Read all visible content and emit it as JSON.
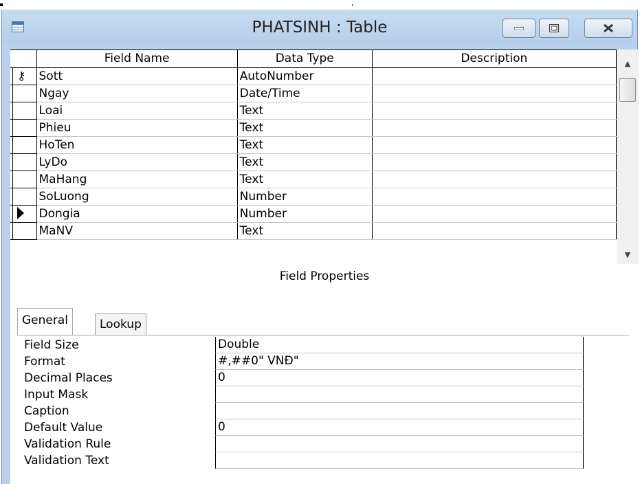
{
  "top_strip_text": ",",
  "window": {
    "title": "PHATSINH : Table",
    "controls": {
      "minimize": "minimize",
      "maximize": "maximize",
      "close": "close"
    }
  },
  "grid": {
    "headers": {
      "field_name": "Field Name",
      "data_type": "Data Type",
      "description": "Description"
    },
    "rows": [
      {
        "field": "Sott",
        "type": "AutoNumber",
        "description": "",
        "selector": "key"
      },
      {
        "field": "Ngay",
        "type": "Date/Time",
        "description": "",
        "selector": ""
      },
      {
        "field": "Loai",
        "type": "Text",
        "description": "",
        "selector": ""
      },
      {
        "field": "Phieu",
        "type": "Text",
        "description": "",
        "selector": ""
      },
      {
        "field": "HoTen",
        "type": "Text",
        "description": "",
        "selector": ""
      },
      {
        "field": "LyDo",
        "type": "Text",
        "description": "",
        "selector": ""
      },
      {
        "field": "MaHang",
        "type": "Text",
        "description": "",
        "selector": ""
      },
      {
        "field": "SoLuong",
        "type": "Number",
        "description": "",
        "selector": ""
      },
      {
        "field": "Dongia",
        "type": "Number",
        "description": "",
        "selector": "current"
      },
      {
        "field": "MaNV",
        "type": "Text",
        "description": "",
        "selector": ""
      }
    ]
  },
  "field_properties": {
    "title": "Field Properties",
    "tabs": {
      "general": "General",
      "lookup": "Lookup"
    },
    "active_tab": "General",
    "rows": [
      {
        "name": "Field Size",
        "value": "Double"
      },
      {
        "name": "Format",
        "value": "#,##0\" VNĐ\""
      },
      {
        "name": "Decimal Places",
        "value": "0"
      },
      {
        "name": "Input Mask",
        "value": ""
      },
      {
        "name": "Caption",
        "value": ""
      },
      {
        "name": "Default Value",
        "value": "0"
      },
      {
        "name": "Validation Rule",
        "value": ""
      },
      {
        "name": "Validation Text",
        "value": ""
      }
    ]
  },
  "icons": {
    "table": "table-icon",
    "primary_key": "key-icon",
    "current_row": "row-pointer-icon"
  },
  "colors": {
    "window_frame": "#b9d1ea"
  }
}
